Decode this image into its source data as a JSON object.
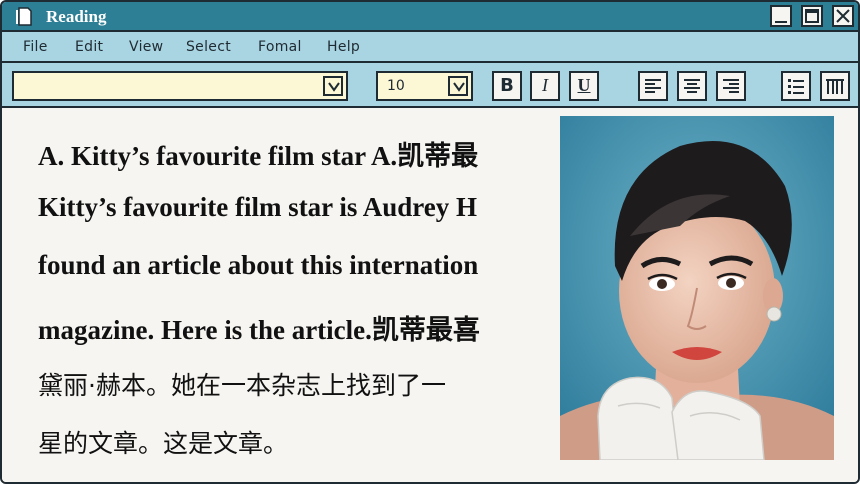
{
  "window": {
    "title": "Reading"
  },
  "menu": [
    "File",
    "Edit",
    "View",
    "Select",
    "Fomal",
    "Help"
  ],
  "toolbar": {
    "font_value": "",
    "font_size": "10",
    "bold": "B",
    "italic": "I",
    "underline": "U"
  },
  "content": {
    "lines": [
      "A. Kitty’s favourite film star A.凯蒂最",
      "Kitty’s favourite film star is Audrey H",
      "found an article about this internation",
      "magazine. Here is the article.凯蒂最喜",
      "黛丽·赫本。她在一本杂志上找到了一",
      "星的文章。这是文章。"
    ]
  },
  "colors": {
    "titlebar": "#2d7f95",
    "menubar": "#a9d4e2",
    "input_bg": "#fcf8d6",
    "border": "#1f2b33",
    "page_bg": "#f6f5f2"
  },
  "icons": [
    "document-icon",
    "minimize-icon",
    "maximize-icon",
    "close-icon",
    "dropdown-arrow-icon",
    "align-left-icon",
    "align-center-icon",
    "align-right-icon",
    "bullet-list-icon",
    "columns-icon"
  ]
}
